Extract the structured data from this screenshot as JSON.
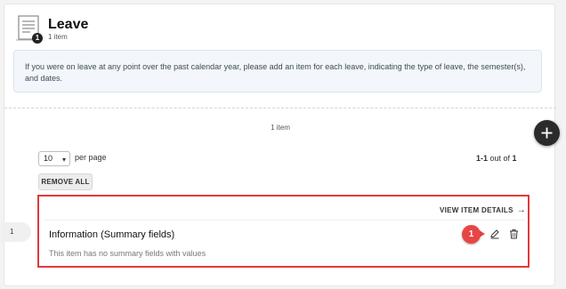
{
  "section": {
    "icon": "document-list-icon",
    "badge_count": "1",
    "title": "Leave",
    "subtitle": "1 item"
  },
  "info": {
    "text": "If you were on leave at any point over the past calendar year, please add an item for each leave, indicating the type of leave, the semester(s), and dates."
  },
  "list": {
    "count_label": "1 item",
    "add_icon": "plus-icon",
    "per_page_value": "10",
    "per_page_label": "per page",
    "range_start": "1-1",
    "range_mid": " out of ",
    "range_total": "1",
    "remove_all_label": "REMOVE ALL"
  },
  "items": [
    {
      "index": "1",
      "view_details_label": "VIEW ITEM DETAILS",
      "title": "Information (Summary fields)",
      "note": "This item has no summary fields with values",
      "step_badge": "1",
      "actions": [
        "edit-icon",
        "trash-icon"
      ]
    }
  ],
  "colors": {
    "highlight": "#e03a3a",
    "step_badge": "#e84545",
    "info_background": "#f3f7fb",
    "add_button": "#2b2b2b"
  }
}
